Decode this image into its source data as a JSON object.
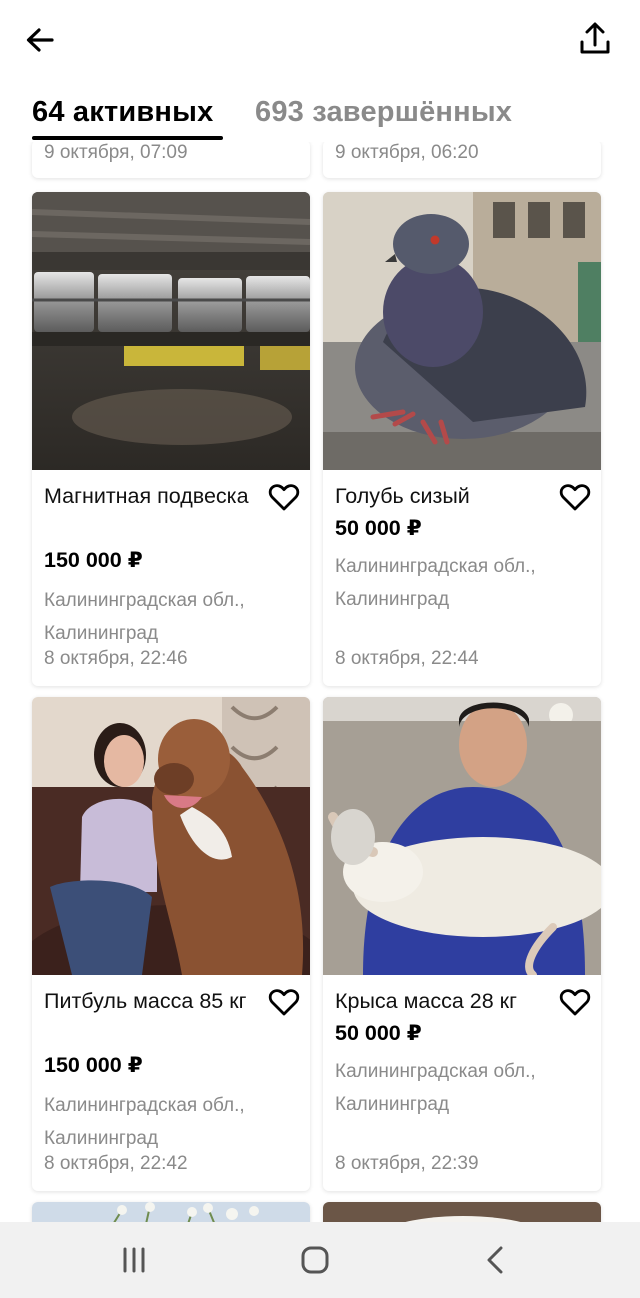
{
  "tabs": {
    "active": "64 активных",
    "completed": "693 завершённых"
  },
  "top_partial_dates": [
    "9 октября, 07:09",
    "9 октября, 06:20"
  ],
  "listings": [
    {
      "title": "Магнитная подвеска",
      "price": "150 000 ₽",
      "location": "Калининградская обл., Калининград",
      "date": "8 октября, 22:46",
      "image": "machinery-photo"
    },
    {
      "title": "Голубь сизый",
      "price": "50 000 ₽",
      "location": "Калининградская обл., Калининград",
      "date": "8 октября, 22:44",
      "image": "pigeon-photo"
    },
    {
      "title": "Питбуль масса 85 кг",
      "price": "150 000 ₽",
      "location": "Калининградская обл., Калининград",
      "date": "8 октября, 22:42",
      "image": "woman-with-pitbull-photo"
    },
    {
      "title": "Крыса масса 28 кг",
      "price": "50 000 ₽",
      "location": "Калининградская обл., Калининград",
      "date": "8 октября, 22:39",
      "image": "man-with-rat-photo"
    }
  ],
  "icons": {
    "back": "arrow-left-icon",
    "share": "share-icon",
    "favorite": "heart-outline-icon",
    "nav_recents": "recents-icon",
    "nav_home": "home-icon",
    "nav_back": "chevron-left-icon"
  },
  "colors": {
    "text_primary": "#000000",
    "text_secondary": "#8a8a8a",
    "navbar_bg": "#f1f1f1"
  }
}
